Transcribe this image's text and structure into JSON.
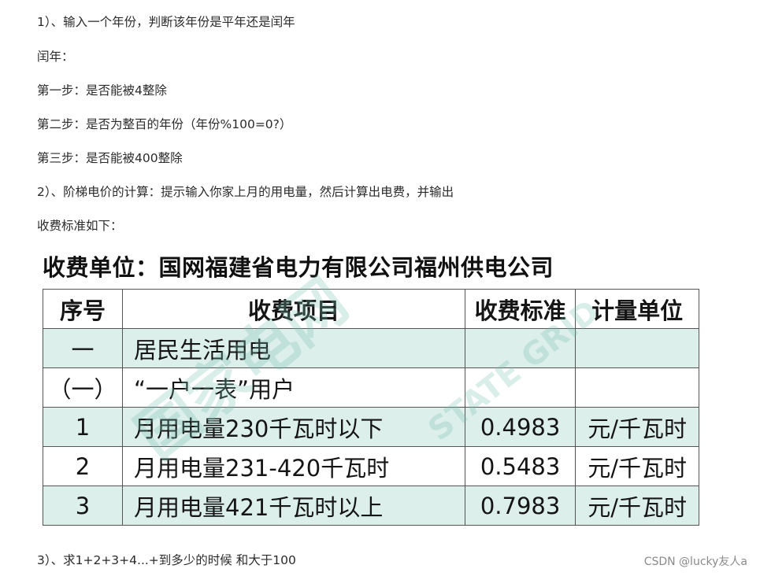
{
  "lines": [
    "1）、输入一个年份，判断该年份是平年还是闰年",
    "闰年：",
    "第一步：是否能被4整除",
    "第二步：是否为整百的年份（年份%100=0?）",
    "第三步：是否能被400整除",
    "2）、阶梯电价的计算：提示输入你家上月的用电量，然后计算出电费，并输出",
    "收费标准如下："
  ],
  "figure": {
    "title": "收费单位：国网福建省电力有限公司福州供电公司",
    "watermark_text": "国家电网",
    "watermark_text2": "STATE GRID",
    "table": {
      "headers": [
        "序号",
        "收费项目",
        "收费标准",
        "计量单位"
      ],
      "rows": [
        [
          "一",
          "居民生活用电",
          "",
          ""
        ],
        [
          "（一）",
          "“一户一表”用户",
          "",
          ""
        ],
        [
          "1",
          "月用电量230千瓦时以下",
          "0.4983",
          "元/千瓦时"
        ],
        [
          "2",
          "月用电量231-420千瓦时",
          "0.5483",
          "元/千瓦时"
        ],
        [
          "3",
          "月用电量421千瓦时以上",
          "0.7983",
          "元/千瓦时"
        ]
      ]
    }
  },
  "question3": "3）、求1+2+3+4...+到多少的时候 和大于100",
  "credit": "CSDN @lucky友人a"
}
